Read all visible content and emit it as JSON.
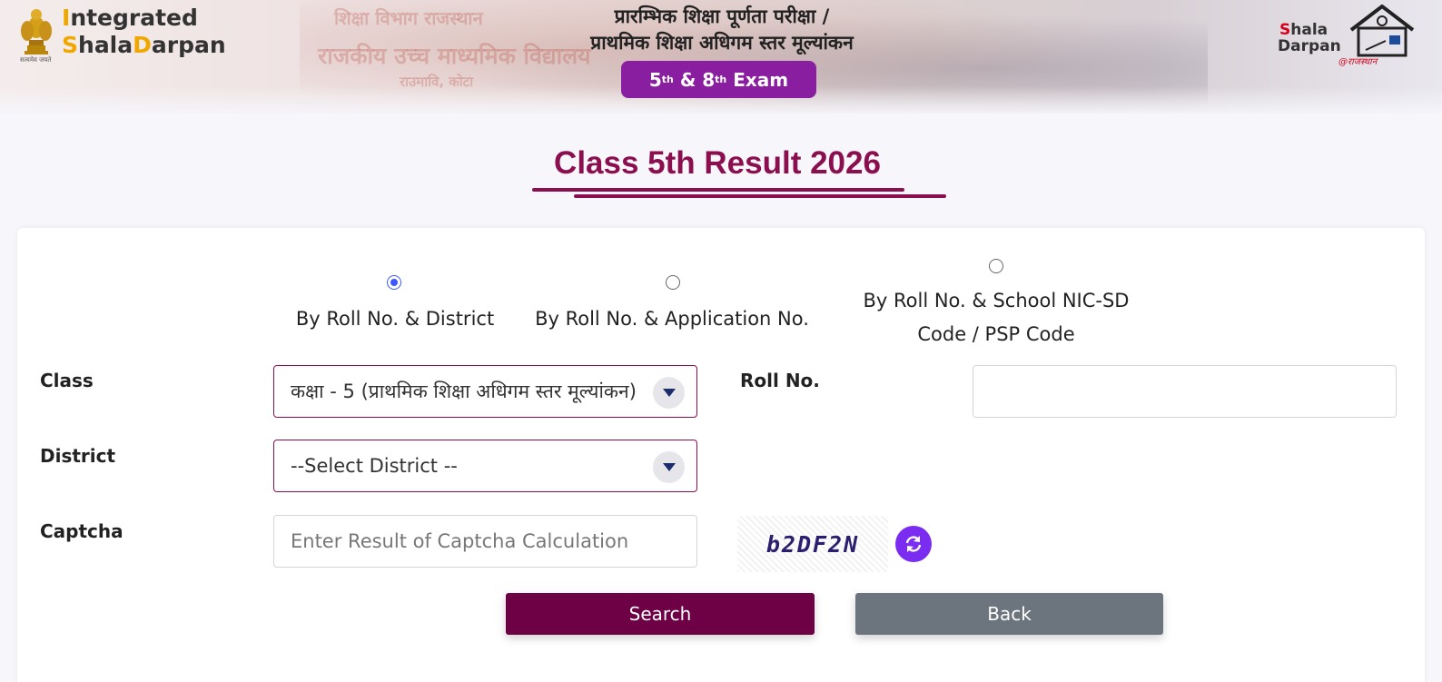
{
  "header": {
    "emblem_caption": "सत्यमेव जयते",
    "brand_line1_accent": "I",
    "brand_line1_rest": "ntegrated",
    "brand_line2_accent": "S",
    "brand_line2_mid": "hala",
    "brand_line2_accent2": "D",
    "brand_line2_rest": "arpan",
    "hindi_title_line1": "प्रारम्भिक शिक्षा पूर्णता परीक्षा /",
    "hindi_title_line2": "प्राथमिक शिक्षा अधिगम स्तर मूल्यांकन",
    "exam_pill": {
      "a": "5",
      "a_sup": "th",
      "mid": " & 8",
      "b_sup": "th",
      "end": " Exam"
    },
    "right_logo": {
      "line1_red": "S",
      "line1_rest": "hala",
      "line2": "Darpan",
      "line3": "@राजस्थान"
    },
    "bg_text_1": "शिक्षा विभाग राजस्थान",
    "bg_text_2": "राजकीय उच्च माध्यमिक विद्यालय",
    "bg_text_3": "राउमावि, कोटा"
  },
  "page_title": "Class 5th Result 2026",
  "search_options": [
    {
      "label": "By Roll No. & District",
      "checked": true
    },
    {
      "label": "By Roll No. & Application No.",
      "checked": false
    },
    {
      "label_line1": "By Roll No. & School NIC-SD",
      "label_line2": "Code / PSP Code",
      "checked": false
    }
  ],
  "form": {
    "class_label": "Class",
    "class_value": "कक्षा - 5 (प्राथमिक शिक्षा अधिगम स्तर मूल्यांकन)",
    "roll_label": "Roll No.",
    "roll_value": "",
    "district_label": "District",
    "district_value": "--Select District --",
    "captcha_label": "Captcha",
    "captcha_placeholder": "Enter Result of Captcha Calculation",
    "captcha_text": "b2DF2N"
  },
  "buttons": {
    "search": "Search",
    "back": "Back"
  },
  "colors": {
    "primary": "#6e0046",
    "title": "#8b0f4f",
    "pill": "#8a1ea0",
    "radio": "#3d57ff",
    "back": "#6c757d",
    "refresh": "#7a2cf0"
  }
}
